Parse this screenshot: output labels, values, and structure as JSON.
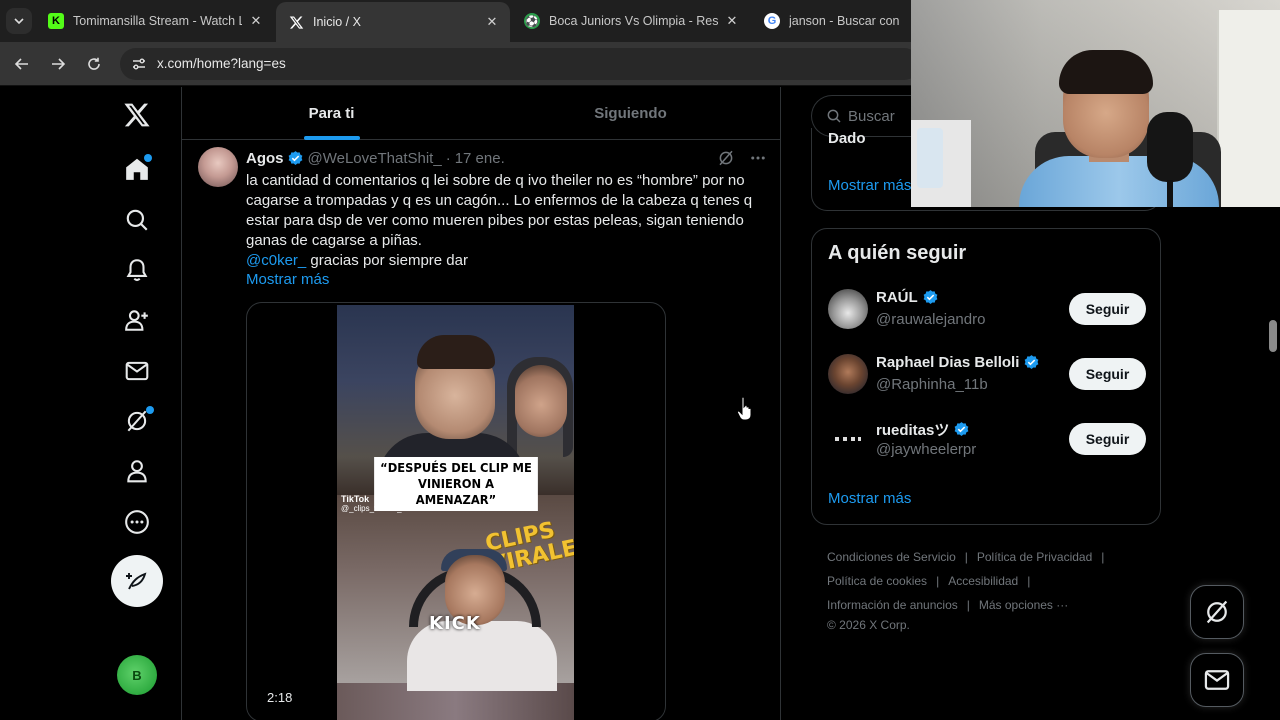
{
  "browser": {
    "tabs": [
      {
        "title": "Tomimansilla Stream - Watch Live",
        "favicon": "kick-icon",
        "active": false
      },
      {
        "title": "Inicio / X",
        "favicon": "x-icon",
        "active": true
      },
      {
        "title": "Boca Juniors Vs Olimpia - Resultados",
        "favicon": "soccer-icon",
        "active": false
      },
      {
        "title": "janson - Buscar con Google",
        "favicon": "google-icon",
        "active": false
      }
    ],
    "url": "x.com/home?lang=es"
  },
  "feed": {
    "tabs": [
      "Para ti",
      "Siguiendo"
    ],
    "active_tab": "Para ti"
  },
  "tweet": {
    "name": "Agos",
    "handle": "@WeLoveThatShit_",
    "separator": "·",
    "date": "17 ene.",
    "text": "la cantidad d comentarios q lei sobre de q ivo theiler no es “hombre” por no cagarse a trompadas y q es un cagón... Lo enfermos de la cabeza q tenes q estar para dsp de ver como mueren pibes por estas peleas, sigan teniendo ganas de cagarse a piñas.",
    "mention": "@c0ker_",
    "mention_text": " gracias por siempre dar",
    "show_more": "Mostrar más",
    "video": {
      "caption": "“DESPUÉS DEL CLIP ME VINIERON A AMENAZAR”",
      "watermark_brand": "TikTok",
      "watermark_handle": "@_clips_virales_remastered",
      "overlay_logo": "CLIPS VIRALES",
      "platform_logo": "KICK",
      "duration": "2:18"
    }
  },
  "sidebar": {
    "search_placeholder": "Buscar",
    "trend_card": {
      "cut_text": "Dado",
      "show_more": "Mostrar más"
    },
    "who_to_follow": {
      "title": "A quién seguir",
      "users": [
        {
          "name": "RAÚL",
          "handle": "@rauwalejandro",
          "button": "Seguir"
        },
        {
          "name": "Raphael Dias Belloli",
          "handle": "@Raphinha_11b",
          "button": "Seguir"
        },
        {
          "name": "rueditasツ",
          "handle": "@jaywheelerpr",
          "button": "Seguir"
        }
      ],
      "show_more": "Mostrar más"
    },
    "footer": {
      "row1": [
        "Condiciones de Servicio",
        "Política de Privacidad"
      ],
      "row2": [
        "Política de cookies",
        "Accesibilidad"
      ],
      "row3": [
        "Información de anuncios",
        "Más opciones ···"
      ],
      "copyright": "© 2026 X Corp."
    }
  },
  "me": {
    "avatar_initial": "B"
  },
  "colors": {
    "accent": "#1d9bf0",
    "background": "#000000",
    "border": "#2f3336",
    "muted": "#71767b"
  }
}
